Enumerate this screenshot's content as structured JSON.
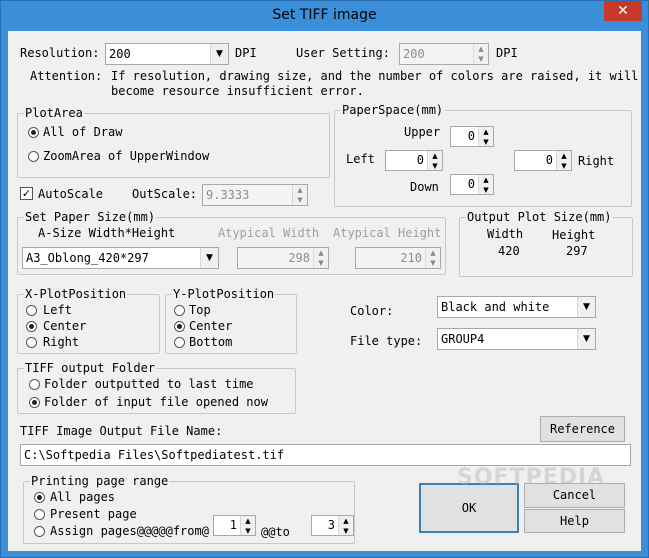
{
  "window": {
    "title": "Set TIFF image",
    "close_glyph": "✕"
  },
  "resolution": {
    "label": "Resolution:",
    "value": "200",
    "unit": "DPI"
  },
  "user_setting": {
    "label": "User Setting:",
    "value": "200",
    "unit": "DPI"
  },
  "attention": {
    "label": "Attention:",
    "line1": "If resolution, drawing size, and the number of colors are raised, it will",
    "line2": "become resource insufficient error."
  },
  "plot_area": {
    "label": "PlotArea",
    "options": [
      "All of Draw",
      "ZoomArea of UpperWindow"
    ],
    "selected_index": 0
  },
  "paper_space": {
    "label": "PaperSpace(mm)",
    "upper_label": "Upper",
    "upper_value": "0",
    "left_label": "Left",
    "left_value": "0",
    "right_label": "Right",
    "right_value": "0",
    "down_label": "Down",
    "down_value": "0"
  },
  "autoscale": {
    "label": "AutoScale",
    "checked": true,
    "check_glyph": "✓",
    "outscale_label": "OutScale:",
    "outscale_value": "9.3333"
  },
  "paper_size": {
    "label": "Set Paper Size(mm)",
    "a_size_label": "A-Size Width*Height",
    "a_size_value": "A3_Oblong_420*297",
    "atypical_width_label": "Atypical Width",
    "atypical_width_value": "298",
    "atypical_height_label": "Atypical Height",
    "atypical_height_value": "210"
  },
  "output_plot_size": {
    "label": "Output Plot Size(mm)",
    "width_label": "Width",
    "width_value": "420",
    "height_label": "Height",
    "height_value": "297"
  },
  "x_plot_position": {
    "label": "X-PlotPosition",
    "options": [
      "Left",
      "Center",
      "Right"
    ],
    "selected_index": 1
  },
  "y_plot_position": {
    "label": "Y-PlotPosition",
    "options": [
      "Top",
      "Center",
      "Bottom"
    ],
    "selected_index": 1
  },
  "color": {
    "label": "Color:",
    "value": "Black and white"
  },
  "file_type": {
    "label": "File type:",
    "value": "GROUP4"
  },
  "tiff_output_folder": {
    "label": "TIFF output Folder",
    "options": [
      "Folder outputted to last time",
      "Folder of input file opened now"
    ],
    "selected_index": 1
  },
  "output_file": {
    "label": "TIFF Image Output File Name:",
    "value": "C:\\Softpedia Files\\Softpediatest.tif",
    "reference_button": "Reference"
  },
  "printing_range": {
    "label": "Printing page range",
    "options": [
      "All pages",
      "Present page",
      "Assign pages@@@@@from@"
    ],
    "selected_index": 0,
    "from_value": "1",
    "to_label": "@@to",
    "to_value": "3"
  },
  "buttons": {
    "ok": "OK",
    "cancel": "Cancel",
    "help": "Help"
  },
  "glyphs": {
    "combo_arrow": "▼",
    "spin_up": "▲",
    "spin_down": "▼"
  },
  "watermark": "SOFTPEDIA",
  "colors": {
    "title_bar": "#3a8fd8",
    "close_button": "#c7392b",
    "dialog_face": "#f0f0f0",
    "default_button_border": "#3c7fb1"
  }
}
